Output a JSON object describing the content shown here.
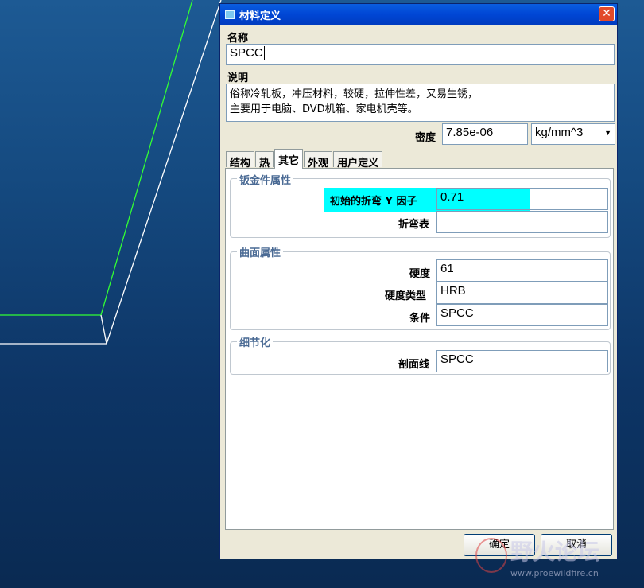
{
  "dialog": {
    "title": "材料定义",
    "name_label": "名称",
    "name_value": "SPCC",
    "description_label": "说明",
    "description_line1": "俗称冷轧板，冲压材料，较硬，拉伸性差，又易生锈，",
    "description_line2": "主要用于电脑、DVD机箱、家电机壳等。",
    "density_label": "密度",
    "density_value": "7.85e-06",
    "density_unit": "kg/mm^3",
    "tabs": [
      "结构",
      "热",
      "其它",
      "外观",
      "用户定义"
    ],
    "active_tab": "其它",
    "sheetmetal": {
      "group_title": "钣金件属性",
      "y_factor_label": "初始的折弯 Y 因子",
      "y_factor_value": "0.71",
      "bend_table_label": "折弯表",
      "bend_table_value": ""
    },
    "surface": {
      "group_title": "曲面属性",
      "hardness_label": "硬度",
      "hardness_value": "61",
      "hardness_type_label": "硬度类型",
      "hardness_type_value": "HRB",
      "condition_label": "条件",
      "condition_value": "SPCC"
    },
    "detail": {
      "group_title": "细节化",
      "section_line_label": "剖面线",
      "section_line_value": "SPCC"
    },
    "ok_label": "确定",
    "cancel_label": "取消"
  },
  "watermark": {
    "text": "野火论坛",
    "url": "www.proewildfire.cn"
  },
  "colors": {
    "highlight": "#00ffff",
    "model_edge_green": "#33ff33",
    "model_edge_white": "#ffffff"
  }
}
